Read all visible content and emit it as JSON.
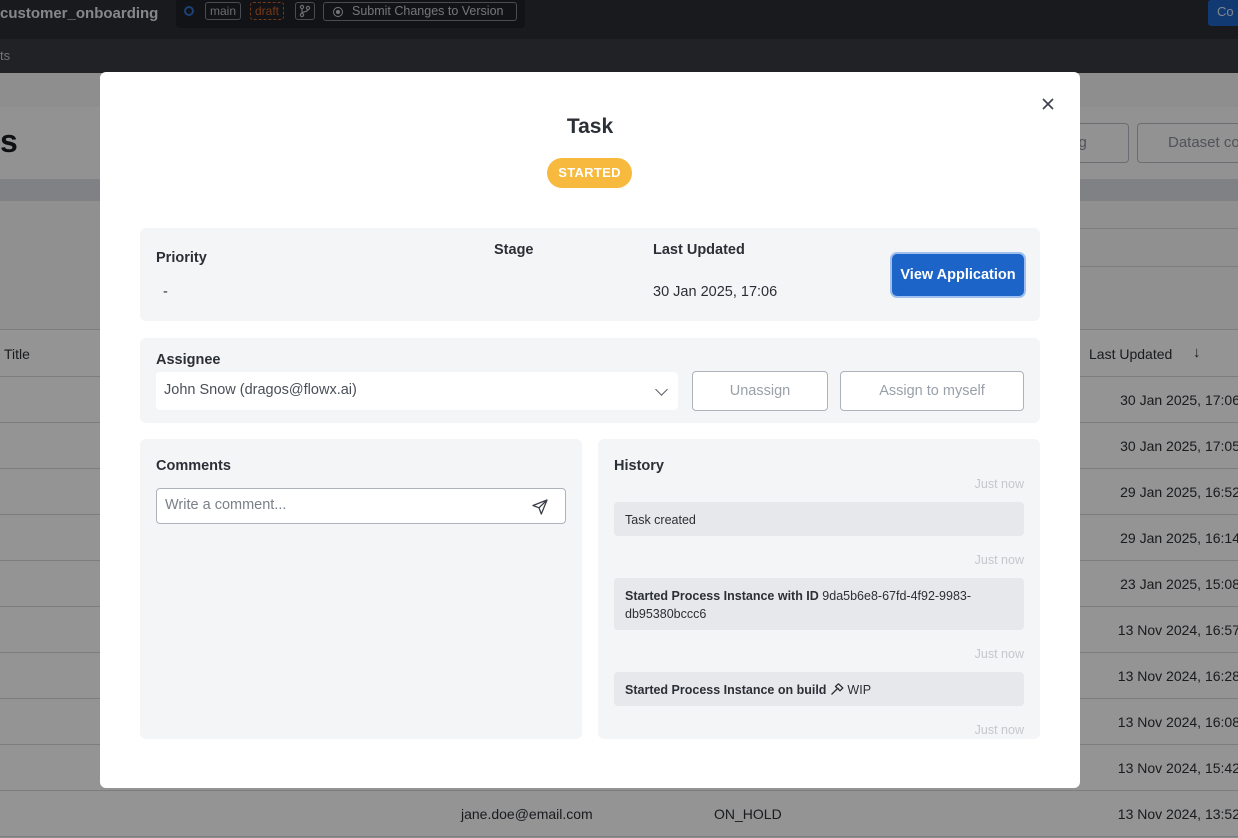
{
  "app": {
    "project_name": "customer_onboarding",
    "branch": "main",
    "draft": "draft",
    "submit_label": "Submit Changes to Version",
    "right_tab": "Co",
    "breadcrumb": "ts",
    "page_heading_fragment": "s",
    "config_button": "fig",
    "dataset_button": "Dataset co",
    "table": {
      "col_title": "Title",
      "col_last_updated": "Last Updated",
      "rows": [
        {
          "date": "30 Jan 2025, 17:06",
          "email": "",
          "status": ""
        },
        {
          "date": "30 Jan 2025, 17:05",
          "email": "",
          "status": ""
        },
        {
          "date": "29 Jan 2025, 16:52",
          "email": "",
          "status": ""
        },
        {
          "date": "29 Jan 2025, 16:14",
          "email": "",
          "status": ""
        },
        {
          "date": "23 Jan 2025, 15:08",
          "email": "",
          "status": ""
        },
        {
          "date": "13 Nov 2024, 16:57",
          "email": "",
          "status": ""
        },
        {
          "date": "13 Nov 2024, 16:28",
          "email": "",
          "status": ""
        },
        {
          "date": "13 Nov 2024, 16:08",
          "email": "",
          "status": ""
        },
        {
          "date": "13 Nov 2024, 15:42",
          "email": "",
          "status": ""
        },
        {
          "date": "13 Nov 2024, 13:52",
          "email": "jane.doe@email.com",
          "status": "ON_HOLD"
        }
      ]
    }
  },
  "modal": {
    "title": "Task",
    "status": "STARTED",
    "status_color": "#f7b93e",
    "priority_label": "Priority",
    "priority_value": "-",
    "stage_label": "Stage",
    "last_updated_label": "Last Updated",
    "last_updated_value": "30 Jan 2025, 17:06",
    "view_application_label": "View Application",
    "assignee_label": "Assignee",
    "assignee_value": "John Snow (dragos@flowx.ai)",
    "unassign_label": "Unassign",
    "assign_to_myself_label": "Assign to myself",
    "comments_label": "Comments",
    "comment_placeholder": "Write a comment...",
    "history_label": "History",
    "history": [
      {
        "time": "Just now",
        "text": "Task created"
      },
      {
        "time": "Just now",
        "bold": "Started Process Instance with ID",
        "text": "9da5b6e8-67fd-4f92-9983-db95380bccc6"
      },
      {
        "time": "Just now",
        "bold": "Started Process Instance on build",
        "text": "WIP"
      },
      {
        "time": "Just now"
      }
    ]
  },
  "icons": {
    "close": "close-icon",
    "chevron": "chevron-down-icon",
    "send": "send-icon",
    "build": "hammer-icon",
    "sort": "arrow-down-icon"
  },
  "colors": {
    "primary": "#1d64c8",
    "topbar": "#2a2d33"
  }
}
